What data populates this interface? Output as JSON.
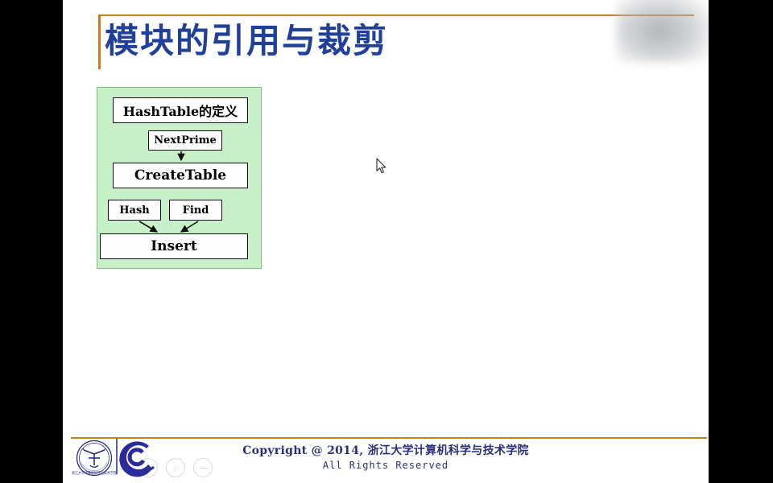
{
  "slide": {
    "title": "模块的引用与裁剪",
    "theme": {
      "accent_rule": "#c97e1e",
      "title_color": "#21409a",
      "panel_fill": "#c8f0c8",
      "panel_border": "#7fbf7f",
      "footer_text_color": "#2d2d7a",
      "letterbox": "#000000"
    }
  },
  "diagram": {
    "name": "module-dependency-diagram",
    "nodes": [
      {
        "id": "hashtable",
        "label": "HashTable的定义"
      },
      {
        "id": "nextprime",
        "label": "NextPrime"
      },
      {
        "id": "createtable",
        "label": "CreateTable"
      },
      {
        "id": "hash",
        "label": "Hash"
      },
      {
        "id": "find",
        "label": "Find"
      },
      {
        "id": "insert",
        "label": "Insert"
      }
    ],
    "edges": [
      {
        "from": "nextprime",
        "to": "createtable"
      },
      {
        "from": "hash",
        "to": "insert"
      },
      {
        "from": "find",
        "to": "insert"
      }
    ]
  },
  "footer": {
    "copyright": "Copyright @ 2014, 浙江大学计算机科学与技术学院",
    "rights": "All Rights Reserved",
    "seal_caption": "浙江大学计算机科学与技术学院"
  },
  "watermark_controls": [
    {
      "name": "zoom-in-icon",
      "glyph": "+"
    },
    {
      "name": "search-icon",
      "glyph": "⌕"
    },
    {
      "name": "zoom-out-icon",
      "glyph": "−"
    }
  ]
}
